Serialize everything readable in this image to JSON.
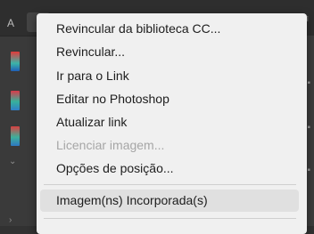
{
  "background": {
    "tab_letter": "A"
  },
  "context_menu": {
    "items": [
      {
        "label": "Revincular da biblioteca CC...",
        "enabled": true
      },
      {
        "label": "Revincular...",
        "enabled": true
      },
      {
        "label": "Ir para o Link",
        "enabled": true
      },
      {
        "label": "Editar no Photoshop",
        "enabled": true
      },
      {
        "label": "Atualizar link",
        "enabled": true
      },
      {
        "label": "Licenciar imagem...",
        "enabled": false
      },
      {
        "label": "Opções de posição...",
        "enabled": true
      },
      {
        "label": "Imagem(ns) Incorporada(s)",
        "enabled": true,
        "highlighted": true
      }
    ]
  },
  "colors": {
    "menu_background": "#f0f0f0",
    "menu_text": "#1d1d1d",
    "disabled_text": "#a6a6a6",
    "highlight": "#e0e0e0",
    "app_background": "#323232"
  }
}
